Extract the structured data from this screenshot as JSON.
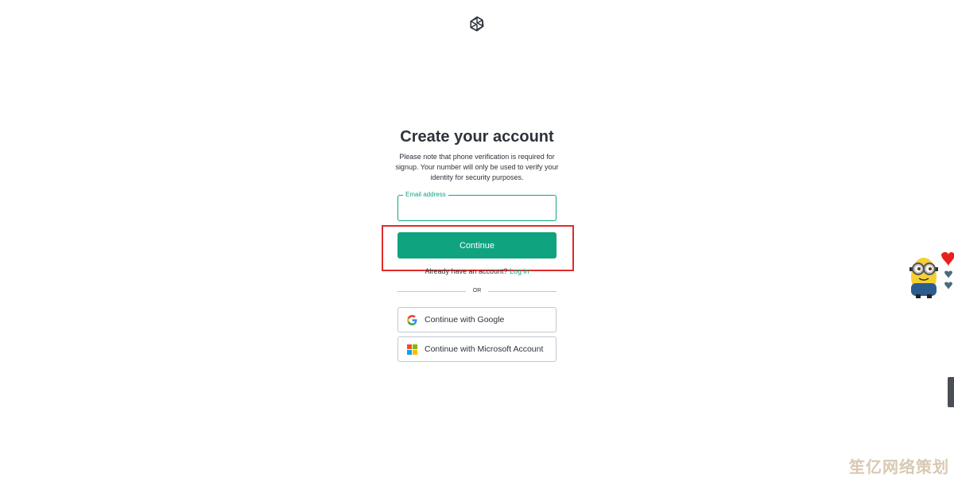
{
  "logo": {
    "icon": "openai-logo-icon"
  },
  "heading": "Create your account",
  "subtitle": "Please note that phone verification is required for signup. Your number will only be used to verify your identity for security purposes.",
  "email": {
    "label": "Email address",
    "value": ""
  },
  "continue_label": "Continue",
  "login_prompt": {
    "text": "Already have an account?",
    "link": "Log in"
  },
  "divider_text": "OR",
  "social": [
    {
      "label": "Continue with Google",
      "icon": "google-icon"
    },
    {
      "label": "Continue with Microsoft Account",
      "icon": "microsoft-icon"
    }
  ],
  "colors": {
    "accent": "#10a37f",
    "highlight": "#e02b2b",
    "border": "#c2c8d0",
    "text": "#2d333a"
  },
  "watermark": "笙亿网络策划"
}
